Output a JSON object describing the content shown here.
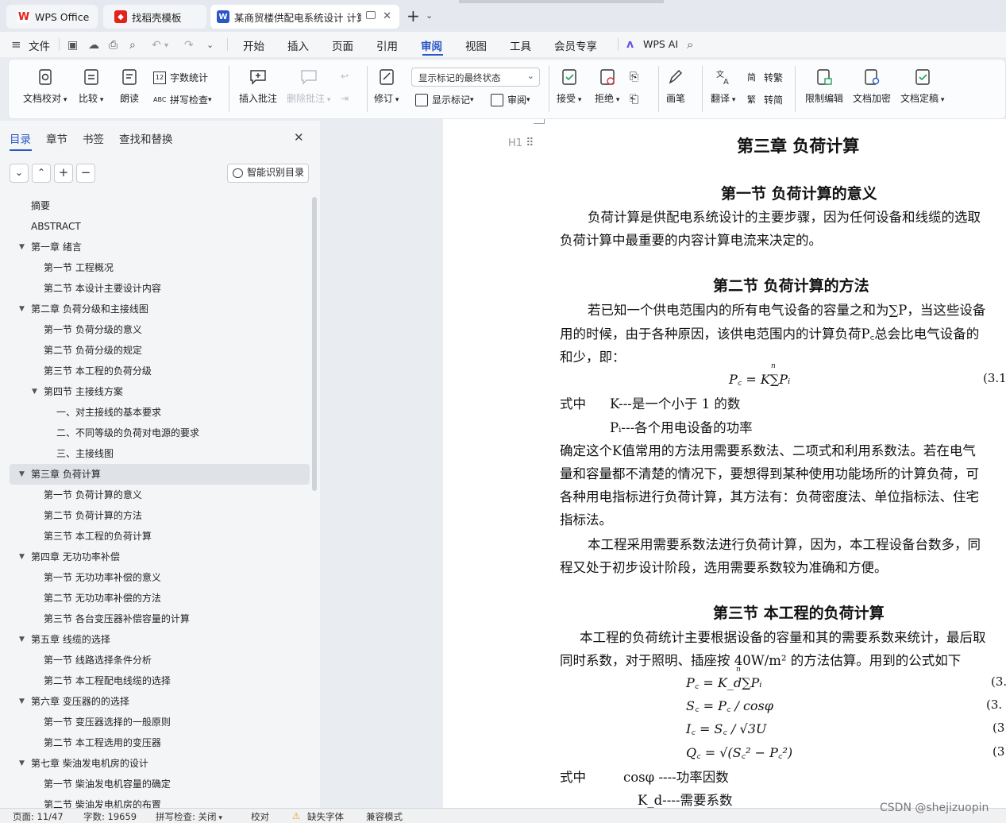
{
  "tabs": [
    {
      "label": "WPS Office",
      "icon_color": "#e2231a"
    },
    {
      "label": "找稻壳模板",
      "icon_color": "#e2231a"
    },
    {
      "label": "某商贸楼供配电系统设计 计算",
      "icon_color": "#2a56c6"
    }
  ],
  "menu": {
    "file": "文件",
    "items": [
      "开始",
      "插入",
      "页面",
      "引用",
      "审阅",
      "视图",
      "工具",
      "会员专享"
    ],
    "active": "审阅",
    "wps_ai": "WPS AI"
  },
  "ribbon": {
    "doc_check": "文档校对",
    "compare": "比较",
    "read_aloud": "朗读",
    "word_count": "字数统计",
    "spell_check": "拼写检查",
    "insert_comment": "插入批注",
    "delete_comment": "删除批注",
    "revise": "修订",
    "markup_state": "显示标记的最终状态",
    "show_markup": "显示标记",
    "review_pane": "审阅",
    "accept": "接受",
    "reject": "拒绝",
    "ink": "画笔",
    "translate": "翻译",
    "to_traditional": "转繁",
    "to_simplified": "转简",
    "restrict_edit": "限制编辑",
    "doc_encrypt": "文档加密",
    "doc_finalize": "文档定稿"
  },
  "nav": {
    "tabs": [
      "目录",
      "章节",
      "书签",
      "查找和替换"
    ],
    "smart_toc": "智能识别目录",
    "toc": [
      {
        "label": "摘要",
        "level": 1,
        "arrow": ""
      },
      {
        "label": "ABSTRACT",
        "level": 1,
        "arrow": ""
      },
      {
        "label": "第一章  绪言",
        "level": 1,
        "arrow": "▼"
      },
      {
        "label": "第一节  工程概况",
        "level": 2,
        "arrow": ""
      },
      {
        "label": "第二节  本设计主要设计内容",
        "level": 2,
        "arrow": ""
      },
      {
        "label": "第二章  负荷分级和主接线图",
        "level": 1,
        "arrow": "▼"
      },
      {
        "label": "第一节  负荷分级的意义",
        "level": 2,
        "arrow": ""
      },
      {
        "label": "第二节  负荷分级的规定",
        "level": 2,
        "arrow": ""
      },
      {
        "label": "第三节  本工程的负荷分级",
        "level": 2,
        "arrow": ""
      },
      {
        "label": "第四节  主接线方案",
        "level": 2,
        "arrow": "▼"
      },
      {
        "label": "一、对主接线的基本要求",
        "level": 3,
        "arrow": ""
      },
      {
        "label": "二、不同等级的负荷对电源的要求",
        "level": 3,
        "arrow": ""
      },
      {
        "label": "三、主接线图",
        "level": 3,
        "arrow": ""
      },
      {
        "label": "第三章  负荷计算",
        "level": 1,
        "arrow": "▼",
        "selected": true
      },
      {
        "label": "第一节  负荷计算的意义",
        "level": 2,
        "arrow": ""
      },
      {
        "label": "第二节  负荷计算的方法",
        "level": 2,
        "arrow": ""
      },
      {
        "label": "第三节  本工程的负荷计算",
        "level": 2,
        "arrow": ""
      },
      {
        "label": "第四章  无功功率补偿",
        "level": 1,
        "arrow": "▼"
      },
      {
        "label": "第一节  无功功率补偿的意义",
        "level": 2,
        "arrow": ""
      },
      {
        "label": "第二节  无功功率补偿的方法",
        "level": 2,
        "arrow": ""
      },
      {
        "label": "第三节  各台变压器补偿容量的计算",
        "level": 2,
        "arrow": ""
      },
      {
        "label": "第五章  线缆的选择",
        "level": 1,
        "arrow": "▼"
      },
      {
        "label": "第一节  线路选择条件分析",
        "level": 2,
        "arrow": ""
      },
      {
        "label": "第二节  本工程配电线缆的选择",
        "level": 2,
        "arrow": ""
      },
      {
        "label": "第六章  变压器的的选择",
        "level": 1,
        "arrow": "▼"
      },
      {
        "label": "第一节  变压器选择的一般原则",
        "level": 2,
        "arrow": ""
      },
      {
        "label": "第二节  本工程选用的变压器",
        "level": 2,
        "arrow": ""
      },
      {
        "label": "第七章  柴油发电机房的设计",
        "level": 1,
        "arrow": "▼"
      },
      {
        "label": "第一节  柴油发电机容量的确定",
        "level": 2,
        "arrow": ""
      },
      {
        "label": "第二节  柴油发电机房的布置",
        "level": 2,
        "arrow": ""
      }
    ]
  },
  "doc": {
    "h1_marker": "H1",
    "chapter_title": "第三章  负荷计算",
    "sec1_title": "第一节  负荷计算的意义",
    "sec1_p1": "负荷计算是供配电系统设计的主要步骤，因为任何设备和线缆的选取",
    "sec1_p2": "负荷计算中最重要的内容计算电流来决定的。",
    "sec2_title": "第二节  负荷计算的方法",
    "sec2_p1": "若已知一个供电范围内的所有电气设备的容量之和为∑P，当这些设备",
    "sec2_p2": "用的时候，由于各种原因，该供电范围内的计算负荷P꜀总会比电气设备的",
    "sec2_p3": "和少，即：",
    "formula1": "P꜀ = K∑Pᵢ",
    "formula1_n": "n",
    "eq1": "(3.1",
    "def_label": "式中",
    "def_k": "K---是一个小于 1 的数",
    "def_pi": "Pᵢ---各个用电设备的功率",
    "sec2_p4": "确定这个K值常用的方法用需要系数法、二项式和利用系数法。若在电气",
    "sec2_p5": "量和容量都不清楚的情况下，要想得到某种使用功能场所的计算负荷，可",
    "sec2_p6": "各种用电指标进行负荷计算，其方法有：负荷密度法、单位指标法、住宅",
    "sec2_p7": "指标法。",
    "sec2_p8": "本工程采用需要系数法进行负荷计算，因为，本工程设备台数多，同",
    "sec2_p9": "程又处于初步设计阶段，选用需要系数较为准确和方便。",
    "sec3_title": "第三节  本工程的负荷计算",
    "sec3_p1": "本工程的负荷统计主要根据设备的容量和其的需要系数来统计，最后取",
    "sec3_p2": "同时系数，对于照明、插座按 40W/m² 的方法估算。用到的公式如下",
    "formula2": "P꜀ = K_d∑Pᵢ",
    "formula3": "S꜀ = P꜀ / cosφ",
    "formula4": "I꜀ = S꜀ / √3U",
    "formula5": "Q꜀ = √(S꜀² − P꜀²)",
    "eq2": "(3.",
    "eq3": "(3.",
    "eq4": "(3",
    "eq5": "(3",
    "def2_label": "式中",
    "def2_cos": "cosφ ----功率因数",
    "def2_kd": "K_d----需要系数"
  },
  "status": {
    "page": "页面: 11/47",
    "words": "字数: 19659",
    "spell": "拼写检查: 关闭",
    "proof": "校对",
    "missing_font": "缺失字体",
    "compat": "兼容模式"
  },
  "watermark": "CSDN @shejizuopin"
}
